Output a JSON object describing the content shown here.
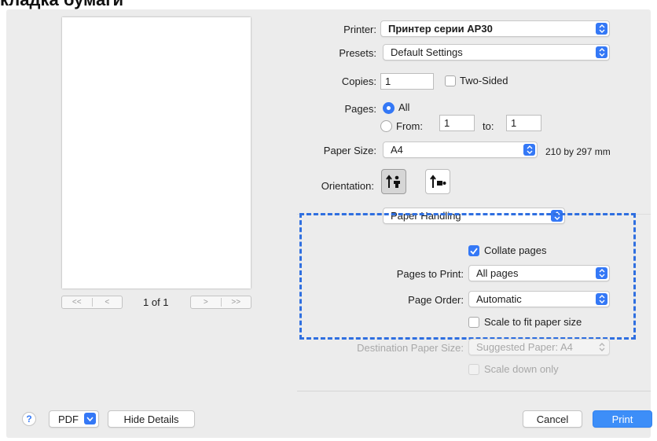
{
  "heading": "кладка бумаги",
  "preview": {
    "page_indicator": "1 of 1",
    "first_label": "<<",
    "prev_label": "<",
    "next_label": ">",
    "last_label": ">>"
  },
  "printer": {
    "label": "Printer:",
    "value": "Принтер серии AP30"
  },
  "presets": {
    "label": "Presets:",
    "value": "Default Settings"
  },
  "copies": {
    "label": "Copies:",
    "value": "1",
    "two_sided_label": "Two-Sided",
    "two_sided_checked": false
  },
  "pages": {
    "label": "Pages:",
    "all_label": "All",
    "from_label": "From:",
    "from_value": "1",
    "to_label": "to:",
    "to_value": "1",
    "selected": "All"
  },
  "paper_size": {
    "label": "Paper Size:",
    "value": "A4",
    "dimensions": "210 by 297 mm"
  },
  "orientation": {
    "label": "Orientation:",
    "selected": "portrait"
  },
  "section_popup": {
    "value": "Paper Handling"
  },
  "paper_handling": {
    "collate_label": "Collate pages",
    "collate_checked": true,
    "pages_to_print_label": "Pages to Print:",
    "pages_to_print_value": "All pages",
    "page_order_label": "Page Order:",
    "page_order_value": "Automatic",
    "scale_label": "Scale to fit paper size",
    "scale_checked": false,
    "destination_label": "Destination Paper Size:",
    "destination_value": "Suggested Paper: A4",
    "scale_down_label": "Scale down only"
  },
  "footer": {
    "help_label": "?",
    "pdf_label": "PDF",
    "hide_details_label": "Hide Details",
    "cancel_label": "Cancel",
    "print_label": "Print"
  },
  "colors": {
    "accent": "#3478f6",
    "highlight_border": "#2f6fe0"
  }
}
